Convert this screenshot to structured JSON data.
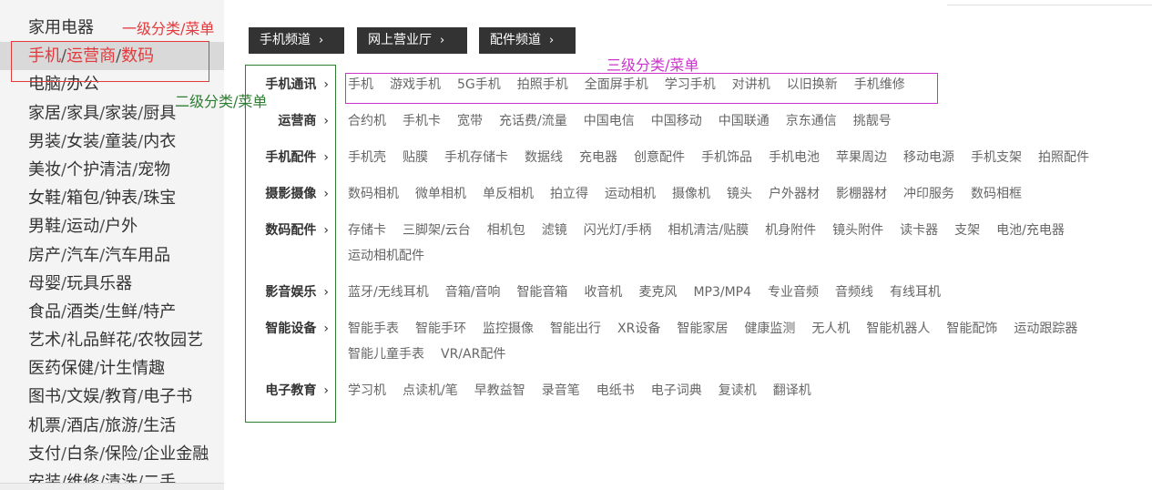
{
  "sidebar": {
    "categories": [
      {
        "parts": [
          "家用电器"
        ]
      },
      {
        "parts": [
          "手机",
          "运营商",
          "数码"
        ]
      },
      {
        "parts": [
          "电脑",
          "办公"
        ]
      },
      {
        "parts": [
          "家居",
          "家具",
          "家装",
          "厨具"
        ]
      },
      {
        "parts": [
          "男装",
          "女装",
          "童装",
          "内衣"
        ]
      },
      {
        "parts": [
          "美妆",
          "个护清洁",
          "宠物"
        ]
      },
      {
        "parts": [
          "女鞋",
          "箱包",
          "钟表",
          "珠宝"
        ]
      },
      {
        "parts": [
          "男鞋",
          "运动",
          "户外"
        ]
      },
      {
        "parts": [
          "房产",
          "汽车",
          "汽车用品"
        ]
      },
      {
        "parts": [
          "母婴",
          "玩具乐器"
        ]
      },
      {
        "parts": [
          "食品",
          "酒类",
          "生鲜",
          "特产"
        ]
      },
      {
        "parts": [
          "艺术",
          "礼品鲜花",
          "农牧园艺"
        ]
      },
      {
        "parts": [
          "医药保健",
          "计生情趣"
        ]
      },
      {
        "parts": [
          "图书",
          "文娱",
          "教育",
          "电子书"
        ]
      },
      {
        "parts": [
          "机票",
          "酒店",
          "旅游",
          "生活"
        ]
      },
      {
        "parts": [
          "支付",
          "白条",
          "保险",
          "企业金融"
        ]
      },
      {
        "parts": [
          "安装",
          "维修",
          "清洗",
          "二手"
        ]
      }
    ],
    "active_index": 1,
    "separator": "/"
  },
  "channels": [
    {
      "label": "手机频道"
    },
    {
      "label": "网上营业厅"
    },
    {
      "label": "配件频道"
    }
  ],
  "chevron": "›",
  "level2": [
    {
      "label": "手机通讯",
      "lines": [
        [
          "手机",
          "游戏手机",
          "5G手机",
          "拍照手机",
          "全面屏手机",
          "学习手机",
          "对讲机",
          "以旧换新",
          "手机维修"
        ]
      ]
    },
    {
      "label": "运营商",
      "lines": [
        [
          "合约机",
          "手机卡",
          "宽带",
          "充话费/流量",
          "中国电信",
          "中国移动",
          "中国联通",
          "京东通信",
          "挑靓号"
        ]
      ]
    },
    {
      "label": "手机配件",
      "lines": [
        [
          "手机壳",
          "贴膜",
          "手机存储卡",
          "数据线",
          "充电器",
          "创意配件",
          "手机饰品",
          "手机电池",
          "苹果周边",
          "移动电源",
          "手机支架",
          "拍照配件"
        ]
      ]
    },
    {
      "label": "摄影摄像",
      "lines": [
        [
          "数码相机",
          "微单相机",
          "单反相机",
          "拍立得",
          "运动相机",
          "摄像机",
          "镜头",
          "户外器材",
          "影棚器材",
          "冲印服务",
          "数码相框"
        ]
      ]
    },
    {
      "label": "数码配件",
      "lines": [
        [
          "存储卡",
          "三脚架/云台",
          "相机包",
          "滤镜",
          "闪光灯/手柄",
          "相机清洁/贴膜",
          "机身附件",
          "镜头附件",
          "读卡器",
          "支架",
          "电池/充电器"
        ],
        [
          "运动相机配件"
        ]
      ]
    },
    {
      "label": "影音娱乐",
      "lines": [
        [
          "蓝牙/无线耳机",
          "音箱/音响",
          "智能音箱",
          "收音机",
          "麦克风",
          "MP3/MP4",
          "专业音频",
          "音频线",
          "有线耳机"
        ]
      ]
    },
    {
      "label": "智能设备",
      "lines": [
        [
          "智能手表",
          "智能手环",
          "监控摄像",
          "智能出行",
          "XR设备",
          "智能家居",
          "健康监测",
          "无人机",
          "智能机器人",
          "智能配饰",
          "运动跟踪器"
        ],
        [
          "智能儿童手表",
          "VR/AR配件"
        ]
      ]
    },
    {
      "label": "电子教育",
      "lines": [
        [
          "学习机",
          "点读机/笔",
          "早教益智",
          "录音笔",
          "电纸书",
          "电子词典",
          "复读机",
          "翻译机"
        ]
      ]
    }
  ],
  "annotations": {
    "level1": "一级分类/菜单",
    "level2": "二级分类/菜单",
    "level3": "三级分类/菜单"
  },
  "colors": {
    "active_text": "#e4393c",
    "annotation_level1": "#e4393c",
    "annotation_level2": "#2e7d32",
    "annotation_level3": "#cc33cc",
    "channel_bg": "#333333"
  }
}
